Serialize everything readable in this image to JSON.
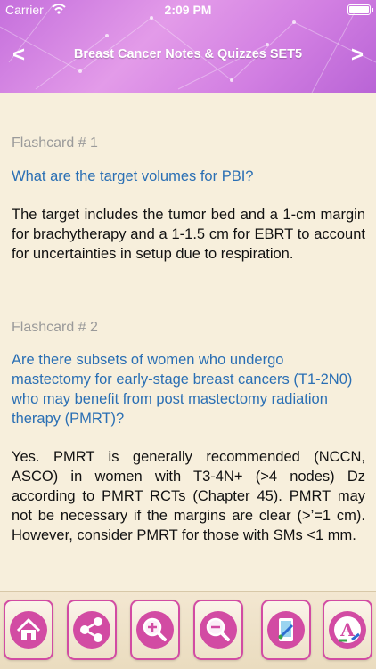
{
  "status_bar": {
    "carrier": "Carrier",
    "time": "2:09 PM"
  },
  "header": {
    "title": "Breast Cancer  Notes & Quizzes SET5",
    "prev": "<",
    "next": ">"
  },
  "flashcards": [
    {
      "label": "Flashcard # 1",
      "question": "What are the target volumes for PBI?",
      "answer": "The target includes the tumor bed and a 1-cm margin for brachytherapy and a 1-1.5 cm for EBRT to account for uncertainties in setup due to respiration."
    },
    {
      "label": "Flashcard # 2",
      "question": "Are there subsets of women who undergo mastectomy for early-stage breast cancers (T1-2N0) who may benefit from post mastectomy radiation therapy (PMRT)?",
      "answer": "Yes. PMRT is generally recommended (NCCN, ASCO) in women with T3-4N+ (>4 nodes) Dz according to PMRT RCTs (Chapter 45). PMRT may not be necessary if the margins are clear (>’=1 cm). However, consider PMRT for those with SMs <1 mm."
    }
  ],
  "toolbar": {
    "buttons": [
      {
        "icon": "home-icon"
      },
      {
        "icon": "share-icon"
      },
      {
        "icon": "zoom-in-icon"
      },
      {
        "icon": "zoom-out-icon"
      },
      {
        "icon": "background-color-icon"
      },
      {
        "icon": "font-color-icon"
      }
    ]
  },
  "colors": {
    "accent": "#d24ba3",
    "question": "#2a6fb4",
    "header": "#d88be6",
    "background": "#f7efdc"
  }
}
